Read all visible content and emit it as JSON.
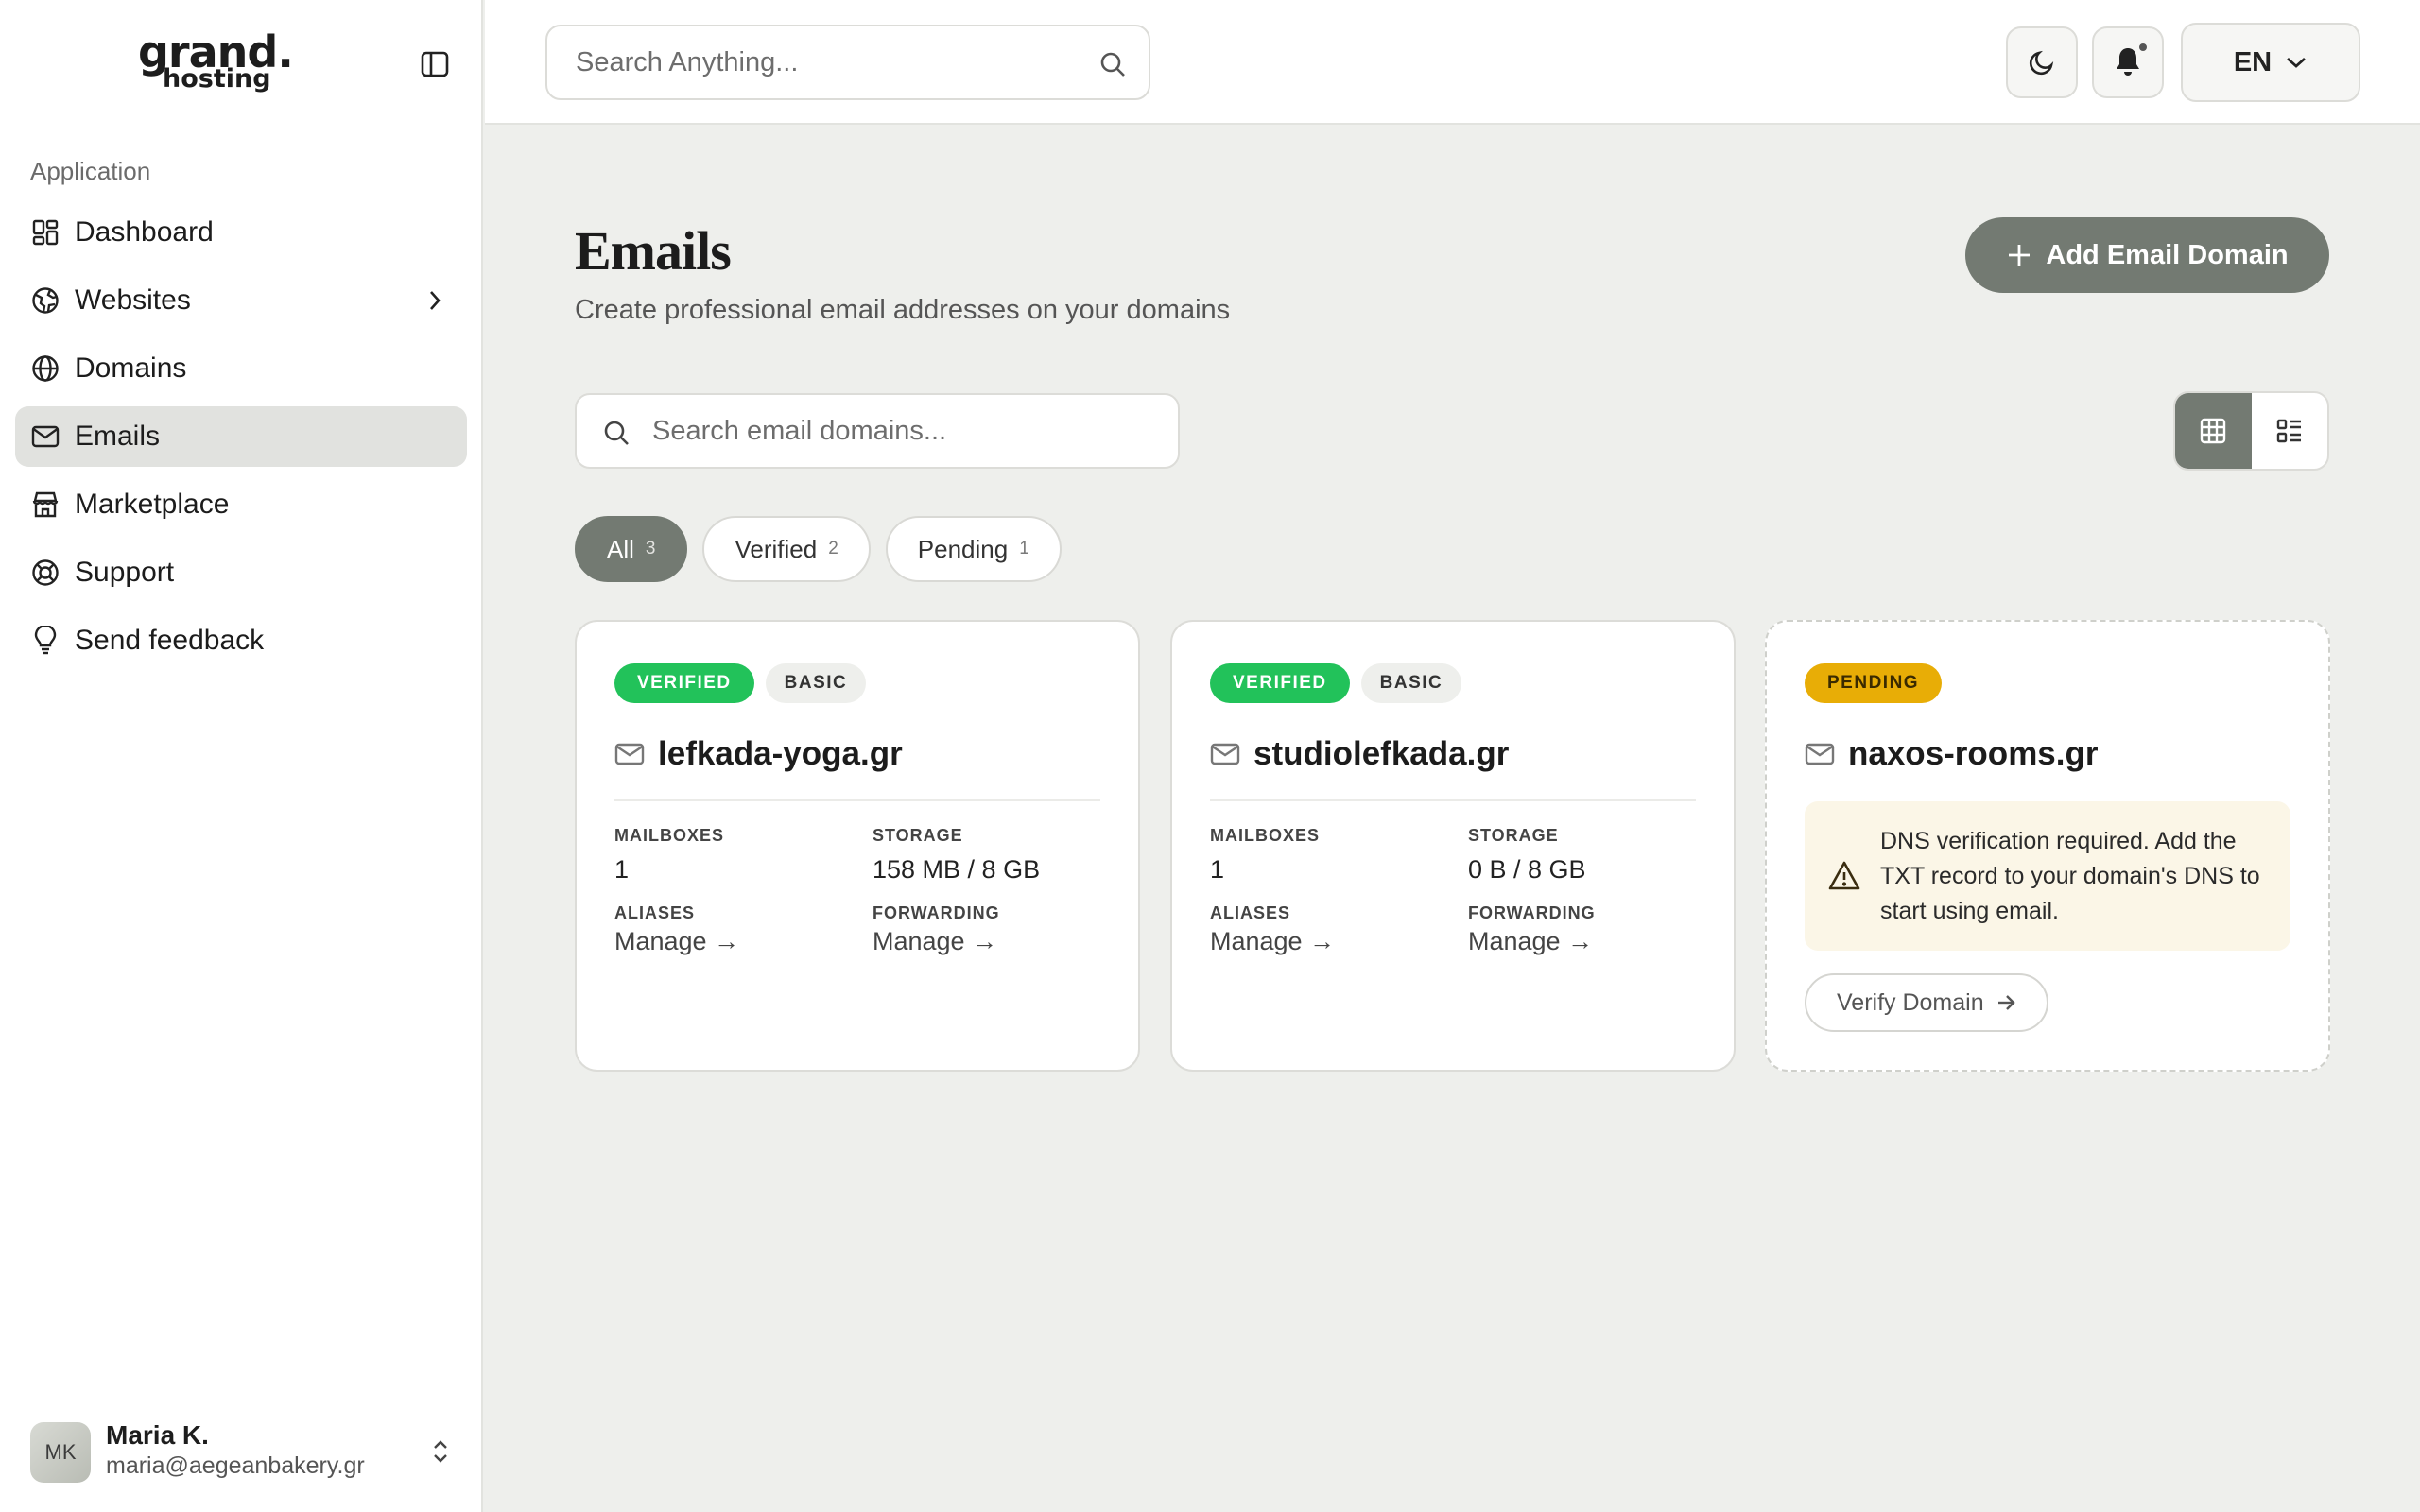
{
  "brand": {
    "logo_main": "grand.",
    "logo_sub": "hosting"
  },
  "sidebar": {
    "section_label": "Application",
    "items": [
      {
        "label": "Dashboard",
        "icon": "dashboard-icon"
      },
      {
        "label": "Websites",
        "icon": "websites-icon",
        "has_submenu": true
      },
      {
        "label": "Domains",
        "icon": "globe-icon"
      },
      {
        "label": "Emails",
        "icon": "mail-icon",
        "active": true
      },
      {
        "label": "Marketplace",
        "icon": "store-icon"
      },
      {
        "label": "Support",
        "icon": "lifebuoy-icon"
      },
      {
        "label": "Send feedback",
        "icon": "lightbulb-icon"
      }
    ]
  },
  "user": {
    "initials": "MK",
    "name": "Maria K.",
    "email": "maria@aegeanbakery.gr"
  },
  "topbar": {
    "search_placeholder": "Search Anything...",
    "language": "EN"
  },
  "page": {
    "title": "Emails",
    "subtitle": "Create professional email addresses on your domains",
    "add_button": "Add Email Domain",
    "domain_search_placeholder": "Search email domains...",
    "view_mode": "grid"
  },
  "filters": [
    {
      "label": "All",
      "count": "3",
      "active": true
    },
    {
      "label": "Verified",
      "count": "2"
    },
    {
      "label": "Pending",
      "count": "1"
    }
  ],
  "cards": [
    {
      "status": "VERIFIED",
      "plan": "BASIC",
      "domain": "lefkada-yoga.gr",
      "mailboxes_label": "MAILBOXES",
      "mailboxes": "1",
      "storage_label": "STORAGE",
      "storage": "158 MB / 8 GB",
      "aliases_label": "ALIASES",
      "aliases_link": "Manage →",
      "forwarding_label": "FORWARDING",
      "forwarding_link": "Manage →"
    },
    {
      "status": "VERIFIED",
      "plan": "BASIC",
      "domain": "studiolefkada.gr",
      "mailboxes_label": "MAILBOXES",
      "mailboxes": "1",
      "storage_label": "STORAGE",
      "storage": "0 B / 8 GB",
      "aliases_label": "ALIASES",
      "aliases_link": "Manage →",
      "forwarding_label": "FORWARDING",
      "forwarding_link": "Manage →"
    },
    {
      "status": "PENDING",
      "domain": "naxos-rooms.gr",
      "alert": "DNS verification required. Add the TXT record to your domain's DNS to start using email.",
      "verify_button": "Verify Domain"
    }
  ],
  "colors": {
    "accent": "#737a72",
    "verified": "#22c25a",
    "pending": "#e8ad06",
    "background": "#eeefec"
  }
}
